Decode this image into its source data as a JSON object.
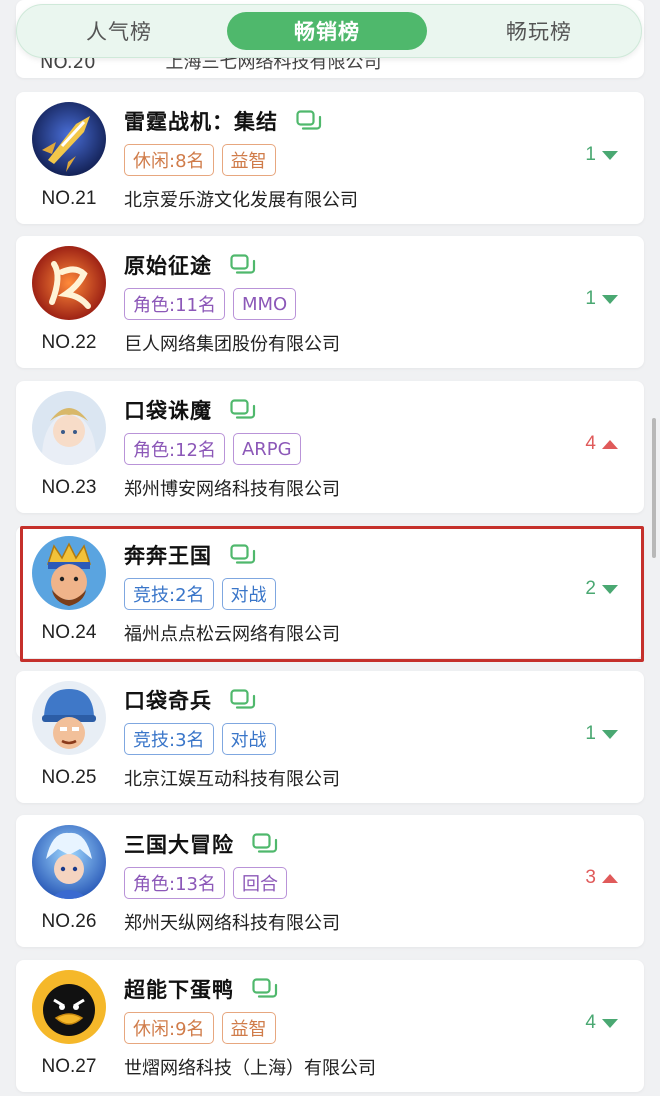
{
  "tabs": [
    {
      "label": "人气榜",
      "active": false
    },
    {
      "label": "畅销榜",
      "active": true
    },
    {
      "label": "畅玩榜",
      "active": false
    }
  ],
  "partial_card": {
    "rank": "NO.20",
    "company": "上海三七网络科技有限公司"
  },
  "games": [
    {
      "rank": "NO.21",
      "name": "雷霆战机：集结",
      "tags": [
        {
          "text": "休闲:8名",
          "color": "orange"
        },
        {
          "text": "益智",
          "color": "orange"
        }
      ],
      "company": "北京爱乐游文化发展有限公司",
      "change": "1",
      "direction": "down",
      "icon": "fighter-jet-avatar"
    },
    {
      "rank": "NO.22",
      "name": "原始征途",
      "tags": [
        {
          "text": "角色:11名",
          "color": "purple"
        },
        {
          "text": "MMO",
          "color": "purple"
        }
      ],
      "company": "巨人网络集团股份有限公司",
      "change": "1",
      "direction": "down",
      "icon": "calligraphy-avatar"
    },
    {
      "rank": "NO.23",
      "name": "口袋诛魔",
      "tags": [
        {
          "text": "角色:12名",
          "color": "purple"
        },
        {
          "text": "ARPG",
          "color": "purple"
        }
      ],
      "company": "郑州博安网络科技有限公司",
      "change": "4",
      "direction": "up",
      "icon": "fairy-girl-avatar"
    },
    {
      "rank": "NO.24",
      "name": "奔奔王国",
      "tags": [
        {
          "text": "竞技:2名",
          "color": "blue"
        },
        {
          "text": "对战",
          "color": "blue"
        }
      ],
      "company": "福州点点松云网络有限公司",
      "change": "2",
      "direction": "down",
      "icon": "king-avatar",
      "highlighted": true
    },
    {
      "rank": "NO.25",
      "name": "口袋奇兵",
      "tags": [
        {
          "text": "竞技:3名",
          "color": "blue"
        },
        {
          "text": "对战",
          "color": "blue"
        }
      ],
      "company": "北京江娱互动科技有限公司",
      "change": "1",
      "direction": "down",
      "icon": "soldier-avatar"
    },
    {
      "rank": "NO.26",
      "name": "三国大冒险",
      "tags": [
        {
          "text": "角色:13名",
          "color": "purple"
        },
        {
          "text": "回合",
          "color": "purple"
        }
      ],
      "company": "郑州天纵网络科技有限公司",
      "change": "3",
      "direction": "up",
      "icon": "warrior-avatar"
    },
    {
      "rank": "NO.27",
      "name": "超能下蛋鸭",
      "tags": [
        {
          "text": "休闲:9名",
          "color": "orange"
        },
        {
          "text": "益智",
          "color": "orange"
        }
      ],
      "company": "世熠网络科技（上海）有限公司",
      "change": "4",
      "direction": "down",
      "icon": "duck-avatar"
    }
  ],
  "colors": {
    "accent": "#4fb86c",
    "down": "#4aa872",
    "up": "#e05a5a",
    "highlight": "#c5302b"
  }
}
